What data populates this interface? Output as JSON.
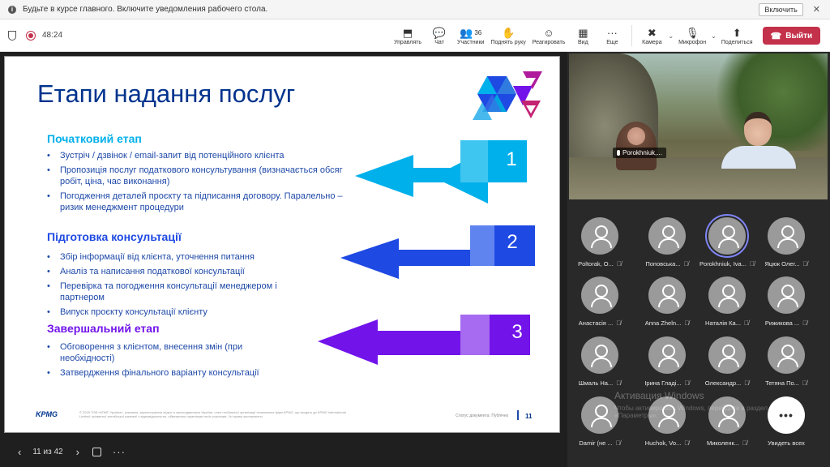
{
  "notification": {
    "text": "Будьте в курсе главного. Включите уведомления рабочего стола.",
    "enable_label": "Включить",
    "close_glyph": "✕"
  },
  "toolbar": {
    "timer": "48:24",
    "tools": [
      {
        "icon": "share-screen-icon",
        "glyph": "⬒",
        "label": "Управлять"
      },
      {
        "icon": "chat-icon",
        "glyph": "💬",
        "label": "Чат"
      },
      {
        "icon": "participants-icon",
        "glyph": "👥",
        "count": "36",
        "label": "Участники"
      },
      {
        "icon": "raise-hand-icon",
        "glyph": "✋",
        "label": "Поднять руку"
      },
      {
        "icon": "react-icon",
        "glyph": "☺",
        "label": "Реагировать"
      },
      {
        "icon": "view-icon",
        "glyph": "▦",
        "label": "Вид"
      },
      {
        "icon": "more-icon",
        "glyph": "···",
        "label": "Еще"
      }
    ],
    "camera_label": "Камера",
    "camera_glyph": "✖",
    "mic_label": "Микрофон",
    "mic_glyph": "🎙",
    "share_label": "Поделиться",
    "share_glyph": "⬆",
    "leave_label": "Выйти",
    "leave_glyph": "☎"
  },
  "slide": {
    "title": "Етапи надання послуг",
    "sections": [
      {
        "heading": "Початковий етап",
        "color": "#00b0eb",
        "number": "1",
        "bullets": [
          "Зустріч / дзвінок / email-запит від потенційного клієнта",
          "Пропозиція послуг податкового консультування (визначається обсяг робіт, ціна, час виконання)",
          "Погодження деталей проєкту та підписання договору. Паралельно – ризик менеджмент процедури"
        ]
      },
      {
        "heading": "Підготовка консультації",
        "color": "#1e49e2",
        "number": "2",
        "bullets": [
          "Збір інформації від клієнта, уточнення питання",
          "Аналіз та написання податкової консультації",
          "Перевірка та погодження консультації менеджером і партнером",
          "Випуск проєкту консультації клієнту"
        ]
      },
      {
        "heading": "Завершальний етап",
        "color": "#7213ea",
        "number": "3",
        "bullets": [
          "Обговорення з клієнтом, внесення змін (при необхідності)",
          "Затвердження фінального варіанту консультації"
        ]
      }
    ],
    "footer_logo": "KPMG",
    "footer_copy": "© 2025 ТОВ «КПМГ Україна», компанія, зареєстрована згідно із законодавством України, член глобальної організації незалежних фірм KPMG, що входять до KPMG International Limited, приватної англійської компанії з відповідальністю, обмеженою гарантіями своїх учасників. Усі права застережено.",
    "footer_status": "Статус документа: Публічно",
    "page_number": "11"
  },
  "nav": {
    "prev_glyph": "‹",
    "page": "11 из 42",
    "next_glyph": "›",
    "more_glyph": "···"
  },
  "video": {
    "speaker_name": "Porokhniuk,..."
  },
  "participants": [
    {
      "name": "Poltorak, O...",
      "active": false
    },
    {
      "name": "Поповська...",
      "active": false
    },
    {
      "name": "Porokhniuk, Iva...",
      "active": true
    },
    {
      "name": "Яцюк Олег...",
      "active": false
    },
    {
      "name": "Анастасія ...",
      "active": false
    },
    {
      "name": "Anna Zheln...",
      "active": false
    },
    {
      "name": "Наталія Ка...",
      "active": false
    },
    {
      "name": "Рижикова ...",
      "active": false
    },
    {
      "name": "Шмаль На...",
      "active": false
    },
    {
      "name": "Ірина Гладі...",
      "active": false
    },
    {
      "name": "Олександр...",
      "active": false
    },
    {
      "name": "Тетяна По...",
      "active": false
    },
    {
      "name": "Damir (не ...",
      "active": false
    },
    {
      "name": "Huchok, Vo...",
      "active": false
    },
    {
      "name": "Миколенк...",
      "active": false
    }
  ],
  "see_all_label": "Увидеть всех",
  "see_all_glyph": "•••",
  "muted_glyph": "🎙̸",
  "windows_watermark": {
    "title": "Активация Windows",
    "subtitle": "Чтобы активировать Windows, перейдите в раздел «Параметры»."
  }
}
